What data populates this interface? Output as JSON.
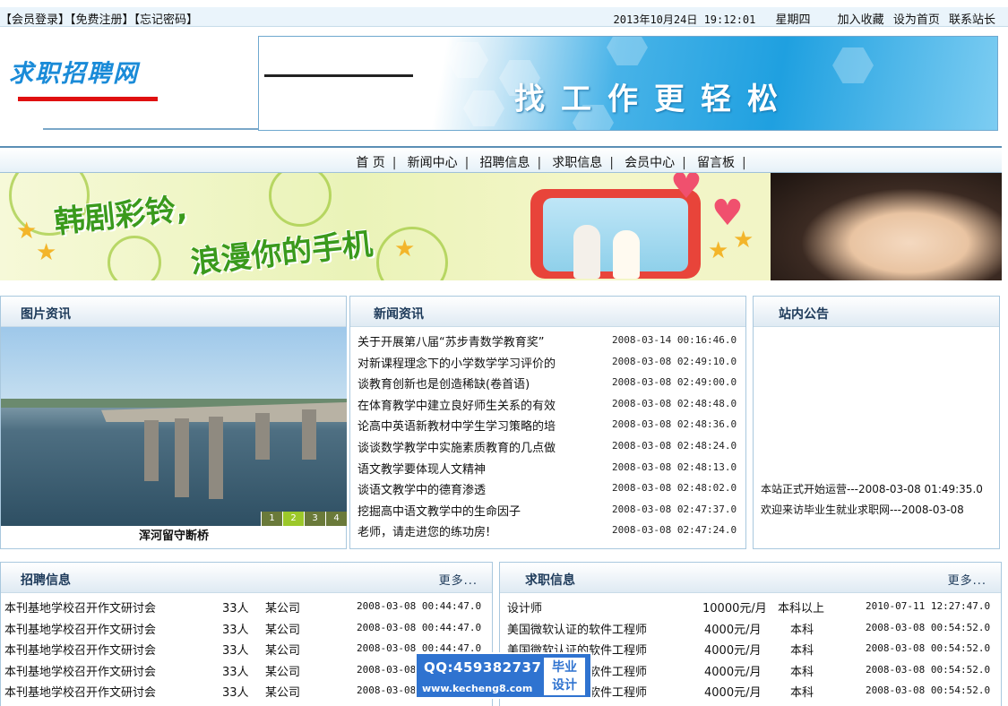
{
  "topbar": {
    "login": "【会员登录】",
    "register": "【免费注册】",
    "forgot": "【忘记密码】",
    "datetime": "2013年10月24日  19:12:01",
    "weekday": "星期四",
    "links": [
      "加入收藏",
      "设为首页",
      "联系站长"
    ]
  },
  "header": {
    "logo": "求职招聘网",
    "slogan": "找工作更轻松"
  },
  "nav": {
    "items": [
      "首 页",
      "新闻中心",
      "招聘信息",
      "求职信息",
      "会员中心",
      "留言板"
    ],
    "separator": "|"
  },
  "ad_banner": {
    "line1": "韩剧彩铃,",
    "line2": "浪漫你的手机"
  },
  "picture_news": {
    "title": "图片资讯",
    "caption": "浑河留守断桥",
    "pages": [
      "1",
      "2",
      "3",
      "4"
    ],
    "active_page": "2"
  },
  "news": {
    "title": "新闻资讯",
    "items": [
      {
        "title": "关于开展第八届“苏步青数学教育奖”",
        "date": "2008-03-14 00:16:46.0"
      },
      {
        "title": "对新课程理念下的小学数学学习评价的",
        "date": "2008-03-08 02:49:10.0"
      },
      {
        "title": "谈教育创新也是创造稀缺(卷首语)",
        "date": "2008-03-08 02:49:00.0"
      },
      {
        "title": "在体育教学中建立良好师生关系的有效",
        "date": "2008-03-08 02:48:48.0"
      },
      {
        "title": "论高中英语新教材中学生学习策略的培",
        "date": "2008-03-08 02:48:36.0"
      },
      {
        "title": "谈谈数学教学中实施素质教育的几点做",
        "date": "2008-03-08 02:48:24.0"
      },
      {
        "title": "语文教学要体现人文精神",
        "date": "2008-03-08 02:48:13.0"
      },
      {
        "title": "谈语文教学中的德育渗透",
        "date": "2008-03-08 02:48:02.0"
      },
      {
        "title": "挖掘高中语文教学中的生命因子",
        "date": "2008-03-08 02:47:37.0"
      },
      {
        "title": "老师，请走进您的练功房!",
        "date": "2008-03-08 02:47:24.0"
      }
    ]
  },
  "notices": {
    "title": "站内公告",
    "items": [
      "本站正式开始运营---2008-03-08 01:49:35.0",
      "欢迎来访毕业生就业求职网---2008-03-08"
    ]
  },
  "jobs": {
    "title": "招聘信息",
    "more": "更多...",
    "rows": [
      {
        "title": "本刊基地学校召开作文研讨会",
        "count": "33人",
        "company": "某公司",
        "date": "2008-03-08 00:44:47.0"
      },
      {
        "title": "本刊基地学校召开作文研讨会",
        "count": "33人",
        "company": "某公司",
        "date": "2008-03-08 00:44:47.0"
      },
      {
        "title": "本刊基地学校召开作文研讨会",
        "count": "33人",
        "company": "某公司",
        "date": "2008-03-08 00:44:47.0"
      },
      {
        "title": "本刊基地学校召开作文研讨会",
        "count": "33人",
        "company": "某公司",
        "date": "2008-03-08 00:44:47.0"
      },
      {
        "title": "本刊基地学校召开作文研讨会",
        "count": "33人",
        "company": "某公司",
        "date": "2008-03-08 00:44:47.0"
      }
    ]
  },
  "seekers": {
    "title": "求职信息",
    "more": "更多...",
    "rows": [
      {
        "title": "设计师",
        "salary": "10000元/月",
        "edu": "本科以上",
        "date": "2010-07-11 12:27:47.0"
      },
      {
        "title": "美国微软认证的软件工程师",
        "salary": "4000元/月",
        "edu": "本科",
        "date": "2008-03-08 00:54:52.0"
      },
      {
        "title": "美国微软认证的软件工程师",
        "salary": "4000元/月",
        "edu": "本科",
        "date": "2008-03-08 00:54:52.0"
      },
      {
        "title": "美国微软认证的软件工程师",
        "salary": "4000元/月",
        "edu": "本科",
        "date": "2008-03-08 00:54:52.0"
      },
      {
        "title": "美国微软认证的软件工程师",
        "salary": "4000元/月",
        "edu": "本科",
        "date": "2008-03-08 00:54:52.0"
      }
    ]
  },
  "watermark": {
    "qq": "QQ:459382737",
    "site": "www.kecheng8.com",
    "tag1": "毕业",
    "tag2": "设计"
  }
}
